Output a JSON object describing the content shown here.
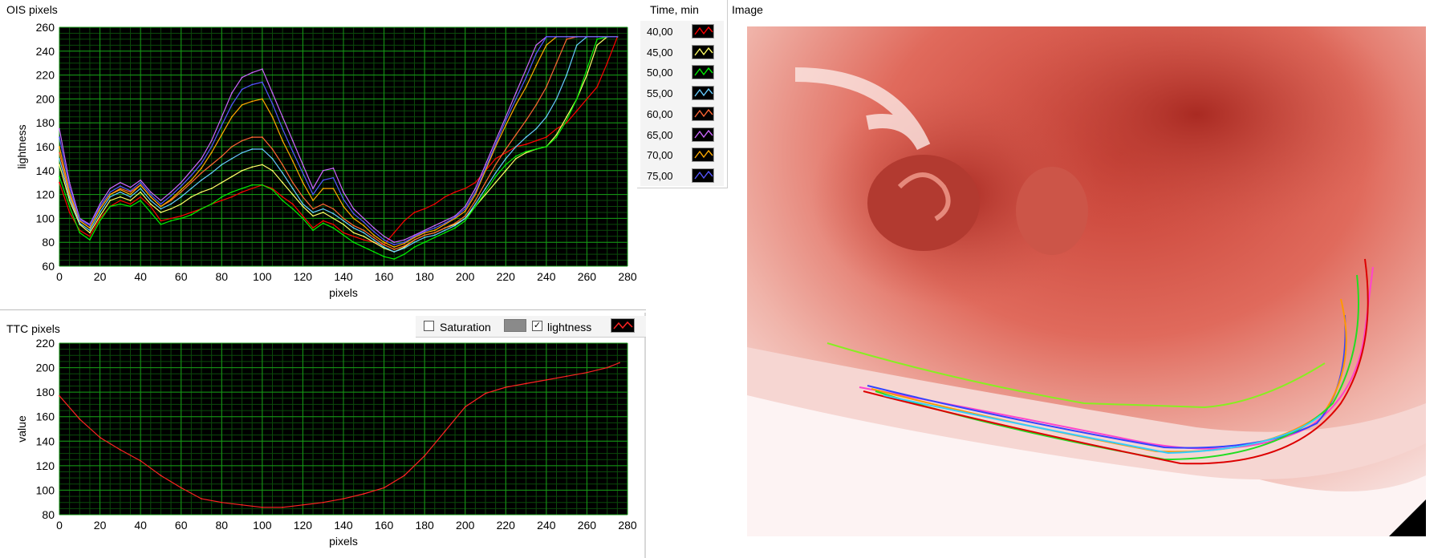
{
  "ois_panel": {
    "title": "OIS pixels",
    "xlabel": "pixels",
    "ylabel": "lightness"
  },
  "ttc_panel": {
    "title": "TTC pixels",
    "xlabel": "pixels",
    "ylabel": "value",
    "toggles": [
      {
        "label": "Saturation",
        "checked": false
      },
      {
        "label": "lightness",
        "checked": true
      }
    ]
  },
  "legend": {
    "title": "Time, min",
    "entries": [
      {
        "label": "40,00",
        "color": "#ff0000"
      },
      {
        "label": "45,00",
        "color": "#ffff66"
      },
      {
        "label": "50,00",
        "color": "#00ee00"
      },
      {
        "label": "55,00",
        "color": "#66ccff"
      },
      {
        "label": "60,00",
        "color": "#ff6633"
      },
      {
        "label": "65,00",
        "color": "#cc66ff"
      },
      {
        "label": "70,00",
        "color": "#ffaa00"
      },
      {
        "label": "75,00",
        "color": "#5555ff"
      }
    ]
  },
  "image_panel": {
    "title": "Image"
  },
  "chart_data": [
    {
      "type": "line",
      "xlim": [
        0,
        280
      ],
      "ylim": [
        60,
        260
      ],
      "xticks": [
        0,
        20,
        40,
        60,
        80,
        100,
        120,
        140,
        160,
        180,
        200,
        220,
        240,
        260,
        280
      ],
      "yticks": [
        60,
        80,
        100,
        120,
        140,
        160,
        180,
        200,
        220,
        240,
        260
      ],
      "grid": true,
      "x": [
        0,
        5,
        10,
        15,
        20,
        25,
        30,
        35,
        40,
        45,
        50,
        55,
        60,
        65,
        70,
        75,
        80,
        85,
        90,
        95,
        100,
        105,
        110,
        115,
        120,
        125,
        130,
        135,
        140,
        145,
        150,
        155,
        160,
        165,
        170,
        175,
        180,
        185,
        190,
        195,
        200,
        205,
        210,
        215,
        220,
        225,
        230,
        235,
        240,
        245,
        250,
        255,
        260,
        265,
        270,
        275
      ],
      "series": [
        {
          "name": "40,00",
          "color": "#ff0000",
          "values": [
            130,
            105,
            90,
            85,
            100,
            110,
            115,
            112,
            118,
            110,
            98,
            100,
            102,
            105,
            108,
            112,
            115,
            118,
            122,
            125,
            128,
            125,
            118,
            112,
            102,
            92,
            98,
            95,
            88,
            85,
            82,
            80,
            78,
            88,
            98,
            105,
            108,
            112,
            118,
            122,
            125,
            130,
            140,
            150,
            155,
            160,
            162,
            165,
            168,
            175,
            180,
            190,
            200,
            210,
            230,
            252
          ]
        },
        {
          "name": "45,00",
          "color": "#ffff66",
          "values": [
            145,
            115,
            95,
            88,
            102,
            115,
            118,
            115,
            122,
            112,
            105,
            108,
            112,
            118,
            122,
            125,
            130,
            135,
            140,
            143,
            145,
            140,
            130,
            120,
            110,
            102,
            105,
            100,
            95,
            88,
            85,
            80,
            75,
            72,
            76,
            82,
            86,
            88,
            92,
            95,
            100,
            110,
            120,
            130,
            140,
            150,
            155,
            158,
            160,
            170,
            185,
            200,
            220,
            245,
            252,
            252
          ]
        },
        {
          "name": "50,00",
          "color": "#00ee00",
          "values": [
            135,
            110,
            88,
            82,
            98,
            110,
            112,
            110,
            115,
            105,
            95,
            98,
            100,
            103,
            108,
            112,
            118,
            122,
            125,
            128,
            128,
            124,
            115,
            108,
            100,
            90,
            96,
            92,
            86,
            80,
            76,
            72,
            68,
            66,
            70,
            76,
            80,
            84,
            88,
            92,
            98,
            110,
            122,
            135,
            145,
            152,
            156,
            158,
            160,
            168,
            182,
            200,
            225,
            250,
            252,
            252
          ]
        },
        {
          "name": "55,00",
          "color": "#66ccff",
          "values": [
            150,
            118,
            96,
            90,
            105,
            118,
            122,
            118,
            125,
            115,
            108,
            112,
            118,
            125,
            132,
            138,
            145,
            150,
            155,
            158,
            158,
            150,
            138,
            125,
            112,
            105,
            108,
            104,
            98,
            92,
            88,
            82,
            76,
            72,
            75,
            80,
            84,
            86,
            90,
            94,
            100,
            112,
            125,
            138,
            150,
            160,
            168,
            175,
            185,
            200,
            220,
            245,
            252,
            252,
            252,
            252
          ]
        },
        {
          "name": "60,00",
          "color": "#ff6633",
          "values": [
            155,
            120,
            98,
            92,
            108,
            120,
            125,
            122,
            128,
            118,
            110,
            115,
            122,
            130,
            138,
            145,
            152,
            160,
            165,
            168,
            168,
            158,
            145,
            130,
            118,
            108,
            112,
            108,
            100,
            94,
            90,
            84,
            78,
            74,
            77,
            82,
            86,
            88,
            92,
            96,
            102,
            115,
            130,
            145,
            158,
            170,
            182,
            195,
            210,
            230,
            250,
            252,
            252,
            252,
            252,
            252
          ]
        },
        {
          "name": "65,00",
          "color": "#cc66ff",
          "values": [
            175,
            130,
            100,
            95,
            112,
            125,
            130,
            126,
            132,
            122,
            115,
            122,
            130,
            140,
            150,
            165,
            185,
            205,
            218,
            222,
            225,
            205,
            185,
            165,
            145,
            125,
            140,
            142,
            122,
            108,
            100,
            92,
            85,
            80,
            82,
            86,
            90,
            94,
            98,
            102,
            110,
            125,
            145,
            165,
            185,
            205,
            225,
            245,
            252,
            252,
            252,
            252,
            252,
            252,
            252,
            252
          ]
        },
        {
          "name": "70,00",
          "color": "#ffaa00",
          "values": [
            160,
            122,
            98,
            92,
            108,
            120,
            124,
            120,
            128,
            118,
            110,
            116,
            124,
            132,
            142,
            155,
            170,
            185,
            195,
            198,
            200,
            185,
            165,
            148,
            130,
            115,
            125,
            125,
            110,
            100,
            94,
            86,
            80,
            76,
            79,
            84,
            88,
            90,
            95,
            100,
            106,
            120,
            140,
            160,
            178,
            195,
            210,
            228,
            245,
            252,
            252,
            252,
            252,
            252,
            252,
            252
          ]
        },
        {
          "name": "75,00",
          "color": "#5555ff",
          "values": [
            168,
            126,
            99,
            94,
            110,
            122,
            127,
            123,
            130,
            120,
            112,
            119,
            127,
            136,
            146,
            160,
            178,
            195,
            208,
            212,
            214,
            196,
            175,
            156,
            138,
            120,
            132,
            134,
            116,
            104,
            97,
            89,
            82,
            78,
            80,
            85,
            89,
            92,
            96,
            101,
            108,
            122,
            142,
            162,
            182,
            200,
            218,
            238,
            252,
            252,
            252,
            252,
            252,
            252,
            252,
            252
          ]
        }
      ]
    },
    {
      "type": "line",
      "xlim": [
        0,
        280
      ],
      "ylim": [
        80,
        220
      ],
      "xticks": [
        0,
        20,
        40,
        60,
        80,
        100,
        120,
        140,
        160,
        180,
        200,
        220,
        240,
        260,
        280
      ],
      "yticks": [
        80,
        100,
        120,
        140,
        160,
        180,
        200,
        220
      ],
      "grid": true,
      "x": [
        0,
        10,
        20,
        30,
        40,
        50,
        60,
        70,
        80,
        90,
        100,
        110,
        120,
        130,
        140,
        150,
        160,
        170,
        180,
        190,
        200,
        210,
        220,
        230,
        240,
        250,
        260,
        270,
        276
      ],
      "series": [
        {
          "name": "lightness",
          "color": "#ff2222",
          "values": [
            177,
            158,
            143,
            133,
            124,
            112,
            102,
            93,
            90,
            88,
            86,
            86,
            88,
            90,
            93,
            97,
            102,
            112,
            128,
            148,
            168,
            179,
            184,
            187,
            190,
            193,
            196,
            200,
            204
          ]
        }
      ]
    }
  ]
}
